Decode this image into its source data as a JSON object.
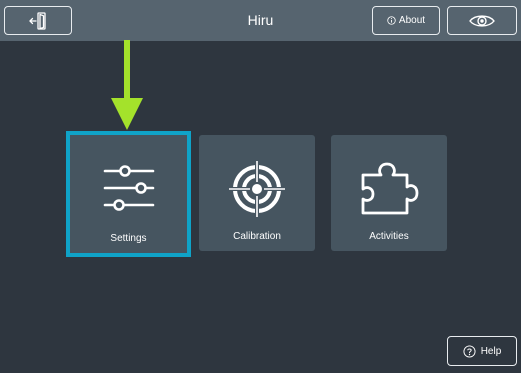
{
  "header": {
    "title": "Hiru",
    "about_label": "About",
    "exit_icon": "exit-icon",
    "eye_icon": "eye-icon"
  },
  "tiles": [
    {
      "label": "Settings",
      "icon": "sliders-icon",
      "highlighted": true
    },
    {
      "label": "Calibration",
      "icon": "target-icon"
    },
    {
      "label": "Activities",
      "icon": "puzzle-icon"
    }
  ],
  "footer": {
    "help_label": "Help"
  },
  "colors": {
    "background": "#2e363f",
    "topbar": "#56646f",
    "tile": "#465560",
    "highlight": "#0fa3c8",
    "arrow": "#a4e22b"
  }
}
